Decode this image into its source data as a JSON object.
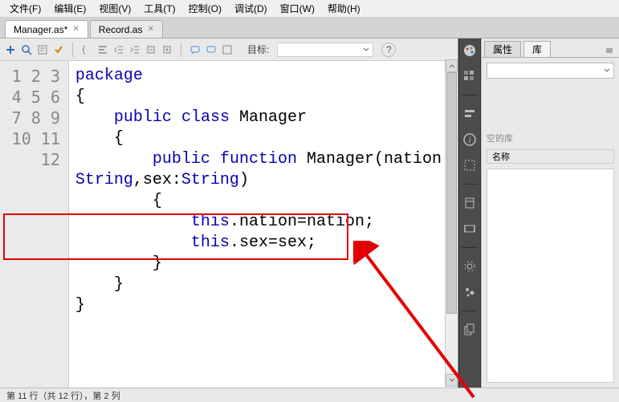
{
  "menu": {
    "file": "文件(F)",
    "edit": "编辑(E)",
    "view": "视图(V)",
    "tools": "工具(T)",
    "control": "控制(O)",
    "debug": "调试(D)",
    "window": "窗口(W)",
    "help": "帮助(H)"
  },
  "tabs": [
    {
      "label": "Manager.as*",
      "active": true
    },
    {
      "label": "Record.as",
      "active": false
    }
  ],
  "toolbar": {
    "target_label": "目标:"
  },
  "code": {
    "lines": [
      1,
      2,
      3,
      4,
      5,
      6,
      7,
      8,
      9,
      10,
      11,
      12
    ],
    "l1_kw": "package",
    "l2": "{",
    "l3_kw1": "public",
    "l3_kw2": "class",
    "l3_id": "Manager",
    "l4": "    {",
    "l5_kw1": "public",
    "l5_kw2": "function",
    "l5_fn": "Manager",
    "l5_arg": "(nation:",
    "l5b_a": "String",
    "l5b_b": ",sex:",
    "l5b_c": "String",
    "l5b_d": ")",
    "l6": "        {",
    "l7_t": "this",
    "l7_r": ".nation=nation;",
    "l8_t": "this",
    "l8_r": ".sex=sex;",
    "l9": "        }",
    "l10": "    }",
    "l11": "}"
  },
  "right": {
    "tab_props": "属性",
    "tab_lib": "库",
    "empty": "空的库",
    "col_name": "名称"
  },
  "status": "第 11 行（共 12 行），第 2 列"
}
